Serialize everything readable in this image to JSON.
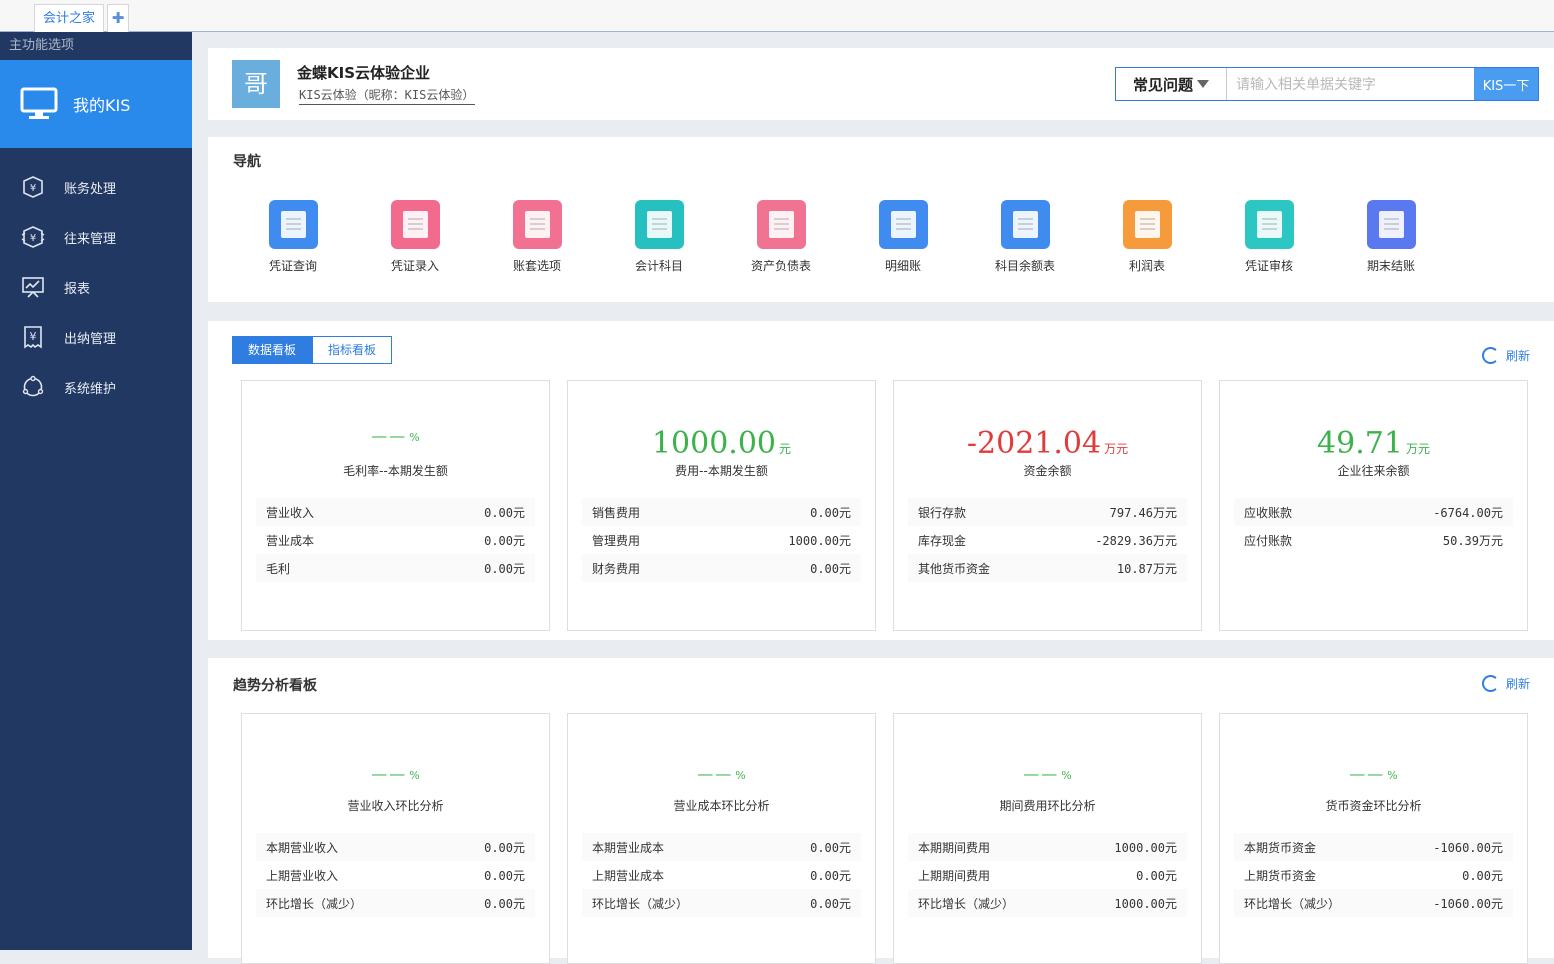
{
  "tabs": {
    "home": "会计之家",
    "add": "✚"
  },
  "sidebar": {
    "title": "主功能选项",
    "home": "我的KIS",
    "items": [
      {
        "label": "账务处理",
        "icon": "yen-shield-icon"
      },
      {
        "label": "往来管理",
        "icon": "yen-exchange-icon"
      },
      {
        "label": "报表",
        "icon": "chart-board-icon"
      },
      {
        "label": "出纳管理",
        "icon": "yen-receipt-icon"
      },
      {
        "label": "系统维护",
        "icon": "cycle-icon"
      }
    ]
  },
  "header": {
    "avatar": "哥",
    "company": "金蝶KIS云体验企业",
    "nickname": "KIS云体验（昵称：KIS云体验）",
    "search": {
      "category": "常见问题",
      "placeholder": "请输入相关单据关键字",
      "button": "KIS一下"
    }
  },
  "nav": {
    "title": "导航",
    "items": [
      {
        "label": "凭证查询",
        "color": "#3f8bf0"
      },
      {
        "label": "凭证录入",
        "color": "#f26b8f"
      },
      {
        "label": "账套选项",
        "color": "#f27092"
      },
      {
        "label": "会计科目",
        "color": "#27c0c0"
      },
      {
        "label": "资产负债表",
        "color": "#f07391"
      },
      {
        "label": "明细账",
        "color": "#3f8bf0"
      },
      {
        "label": "科目余额表",
        "color": "#3f8bf0"
      },
      {
        "label": "利润表",
        "color": "#f59b3c"
      },
      {
        "label": "凭证审核",
        "color": "#2cc7c2"
      },
      {
        "label": "期末结账",
        "color": "#5a78f0"
      }
    ]
  },
  "board": {
    "tabs": [
      "数据看板",
      "指标看板"
    ],
    "refresh": "刷新",
    "cards": [
      {
        "value": "——",
        "unit": "%",
        "color": "#3bb34a",
        "caption": "毛利率--本期发生额",
        "rows": [
          [
            "营业收入",
            "0.00元"
          ],
          [
            "营业成本",
            "0.00元"
          ],
          [
            "毛利",
            "0.00元"
          ]
        ]
      },
      {
        "value": "1000.00",
        "unit": "元",
        "color": "#3bb34a",
        "caption": "费用--本期发生额",
        "rows": [
          [
            "销售费用",
            "0.00元"
          ],
          [
            "管理费用",
            "1000.00元"
          ],
          [
            "财务费用",
            "0.00元"
          ]
        ]
      },
      {
        "value": "-2021.04",
        "unit": "万元",
        "color": "#e23b3b",
        "caption": "资金余额",
        "rows": [
          [
            "银行存款",
            "797.46万元"
          ],
          [
            "库存现金",
            "-2829.36万元"
          ],
          [
            "其他货币资金",
            "10.87万元"
          ]
        ]
      },
      {
        "value": "49.71",
        "unit": "万元",
        "color": "#3bb34a",
        "caption": "企业往来余额",
        "rows": [
          [
            "应收账款",
            "-6764.00元"
          ],
          [
            "应付账款",
            "50.39万元"
          ]
        ]
      }
    ]
  },
  "trend": {
    "title": "趋势分析看板",
    "refresh": "刷新",
    "cards": [
      {
        "value": "——",
        "unit": "%",
        "color": "#3bb34a",
        "caption": "营业收入环比分析",
        "rows": [
          [
            "本期营业收入",
            "0.00元"
          ],
          [
            "上期营业收入",
            "0.00元"
          ],
          [
            "环比增长（减少）",
            "0.00元"
          ]
        ]
      },
      {
        "value": "——",
        "unit": "%",
        "color": "#3bb34a",
        "caption": "营业成本环比分析",
        "rows": [
          [
            "本期营业成本",
            "0.00元"
          ],
          [
            "上期营业成本",
            "0.00元"
          ],
          [
            "环比增长（减少）",
            "0.00元"
          ]
        ]
      },
      {
        "value": "——",
        "unit": "%",
        "color": "#3bb34a",
        "caption": "期间费用环比分析",
        "rows": [
          [
            "本期期间费用",
            "1000.00元"
          ],
          [
            "上期期间费用",
            "0.00元"
          ],
          [
            "环比增长（减少）",
            "1000.00元"
          ]
        ]
      },
      {
        "value": "——",
        "unit": "%",
        "color": "#3bb34a",
        "caption": "货币资金环比分析",
        "rows": [
          [
            "本期货币资金",
            "-1060.00元"
          ],
          [
            "上期货币资金",
            "0.00元"
          ],
          [
            "环比增长（减少）",
            "-1060.00元"
          ]
        ]
      }
    ]
  }
}
